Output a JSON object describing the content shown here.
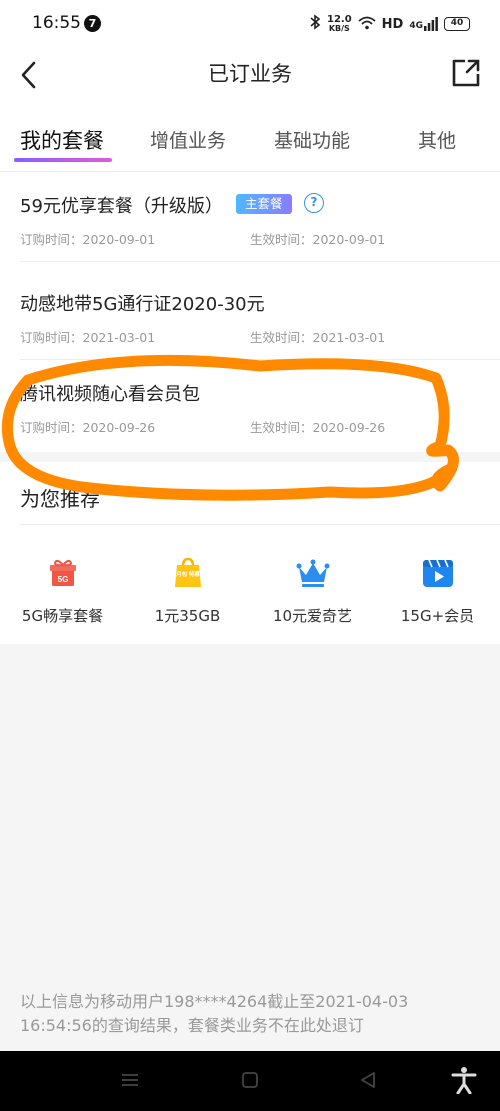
{
  "status_bar": {
    "time": "16:55",
    "notification_count": "7",
    "net_speed_value": "12.0",
    "net_speed_unit": "KB/S",
    "hd_label": "HD",
    "network_label": "4G",
    "battery": "40"
  },
  "header": {
    "title": "已订业务",
    "back_icon": "chevron-left-icon",
    "share_icon": "share-out-icon"
  },
  "tabs": [
    {
      "label": "我的套餐",
      "active": true
    },
    {
      "label": "增值业务",
      "active": false
    },
    {
      "label": "基础功能",
      "active": false
    },
    {
      "label": "其他",
      "active": false
    }
  ],
  "packages": [
    {
      "name": "59元优享套餐（升级版）",
      "badge": "主套餐",
      "order_time": "订购时间：2020-09-01",
      "effect_time": "生效时间：2020-09-01"
    },
    {
      "name": "动感地带5G通行证2020-30元",
      "order_time": "订购时间：2021-03-01",
      "effect_time": "生效时间：2021-03-01"
    },
    {
      "name": "腾讯视频随心看会员包",
      "order_time": "订购时间：2020-09-26",
      "effect_time": "生效时间：2020-09-26"
    }
  ],
  "recommend": {
    "title": "为您推荐",
    "items": [
      {
        "label": "5G畅享套餐",
        "icon": "gift-5g-icon",
        "icon_text": "5G"
      },
      {
        "label": "1元35GB",
        "icon": "shopping-bag-icon",
        "icon_text": "月包 特惠"
      },
      {
        "label": "10元爱奇艺",
        "icon": "crown-icon"
      },
      {
        "label": "15G+会员",
        "icon": "video-play-icon"
      }
    ]
  },
  "footer": {
    "info": "以上信息为移动用户198****4264截止至2021-04-03 16:54:56的查询结果，套餐类业务不在此处退订"
  },
  "colors": {
    "tab_underline_start": "#8a5cff",
    "tab_underline_end": "#e35bd8",
    "badge_start": "#4fb8ff",
    "badge_end": "#8a7cff",
    "scribble": "#ff8a00"
  }
}
